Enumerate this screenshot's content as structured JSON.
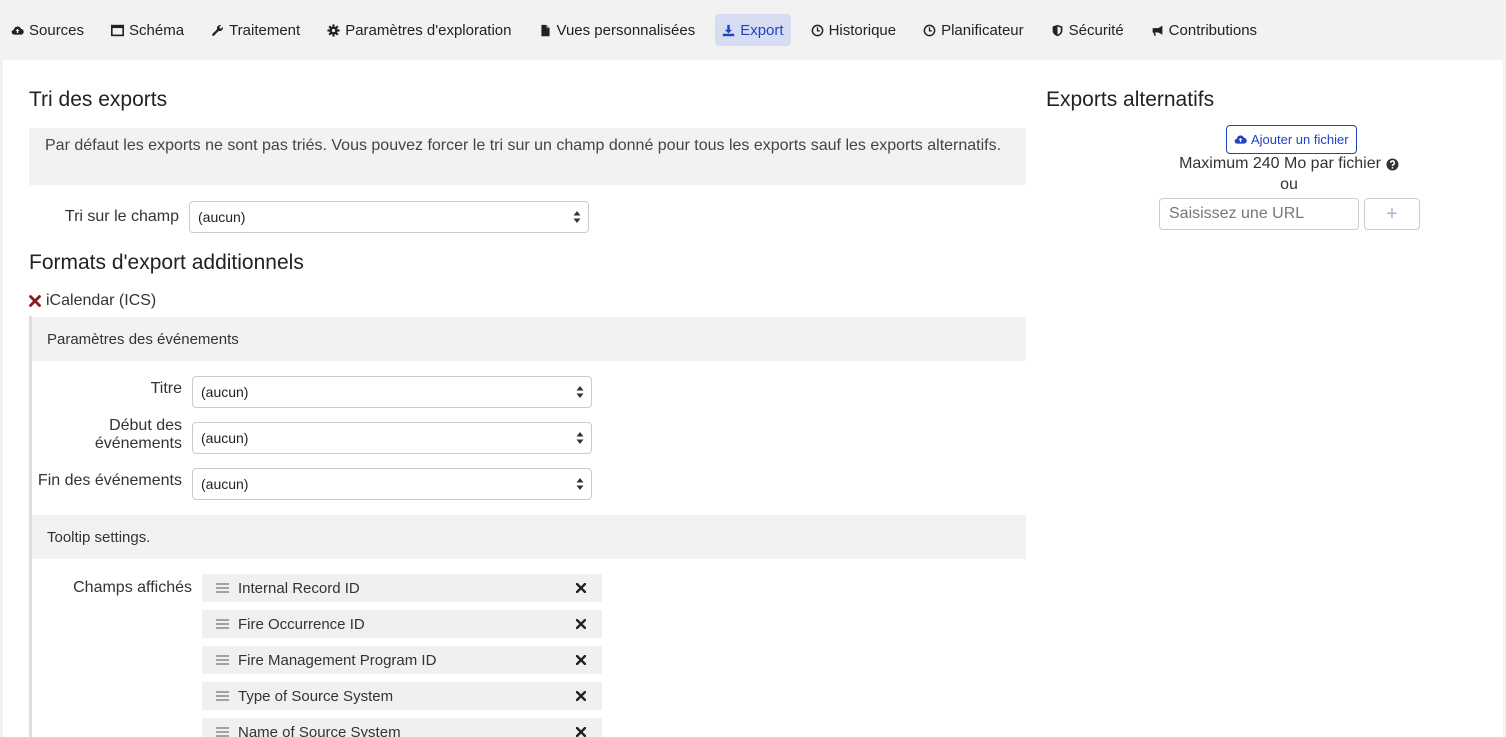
{
  "nav": [
    {
      "label": "Sources",
      "icon": "cloud-upload-icon",
      "active": false
    },
    {
      "label": "Schéma",
      "icon": "window-icon",
      "active": false
    },
    {
      "label": "Traitement",
      "icon": "wrench-icon",
      "active": false
    },
    {
      "label": "Paramètres d'exploration",
      "icon": "gear-icon",
      "active": false
    },
    {
      "label": "Vues personnalisées",
      "icon": "file-icon",
      "active": false
    },
    {
      "label": "Export",
      "icon": "download-icon",
      "active": true
    },
    {
      "label": "Historique",
      "icon": "clock-icon",
      "active": false
    },
    {
      "label": "Planificateur",
      "icon": "clock-icon",
      "active": false
    },
    {
      "label": "Sécurité",
      "icon": "shield-icon",
      "active": false
    },
    {
      "label": "Contributions",
      "icon": "bullhorn-icon",
      "active": false
    }
  ],
  "sort": {
    "title": "Tri des exports",
    "info": "Par défaut les exports ne sont pas triés. Vous pouvez forcer le tri sur un champ donné pour tous les exports sauf les exports alternatifs.",
    "field_label": "Tri sur le champ",
    "field_value": "(aucun)"
  },
  "formats": {
    "title": "Formats d'export additionnels",
    "format_name": "iCalendar (ICS)",
    "events_header": "Paramètres des événements",
    "fields": [
      {
        "label": "Titre",
        "value": "(aucun)"
      },
      {
        "label": "Début des événements",
        "value": "(aucun)"
      },
      {
        "label": "Fin des événements",
        "value": "(aucun)"
      }
    ],
    "tooltip_header": "Tooltip settings.",
    "displayed_label": "Champs affichés",
    "displayed_fields": [
      "Internal Record ID",
      "Fire Occurrence ID",
      "Fire Management Program ID",
      "Type of Source System",
      "Name of Source System"
    ]
  },
  "alt_exports": {
    "title": "Exports alternatifs",
    "upload_label": "Ajouter un fichier",
    "max_text": "Maximum 240 Mo par fichier",
    "or_text": "ou",
    "url_placeholder": "Saisissez une URL",
    "add_label": "+"
  },
  "colors": {
    "accent": "#2142c3",
    "active_tab_bg": "#d6ddf3",
    "remove_format": "#8b1a1a"
  }
}
